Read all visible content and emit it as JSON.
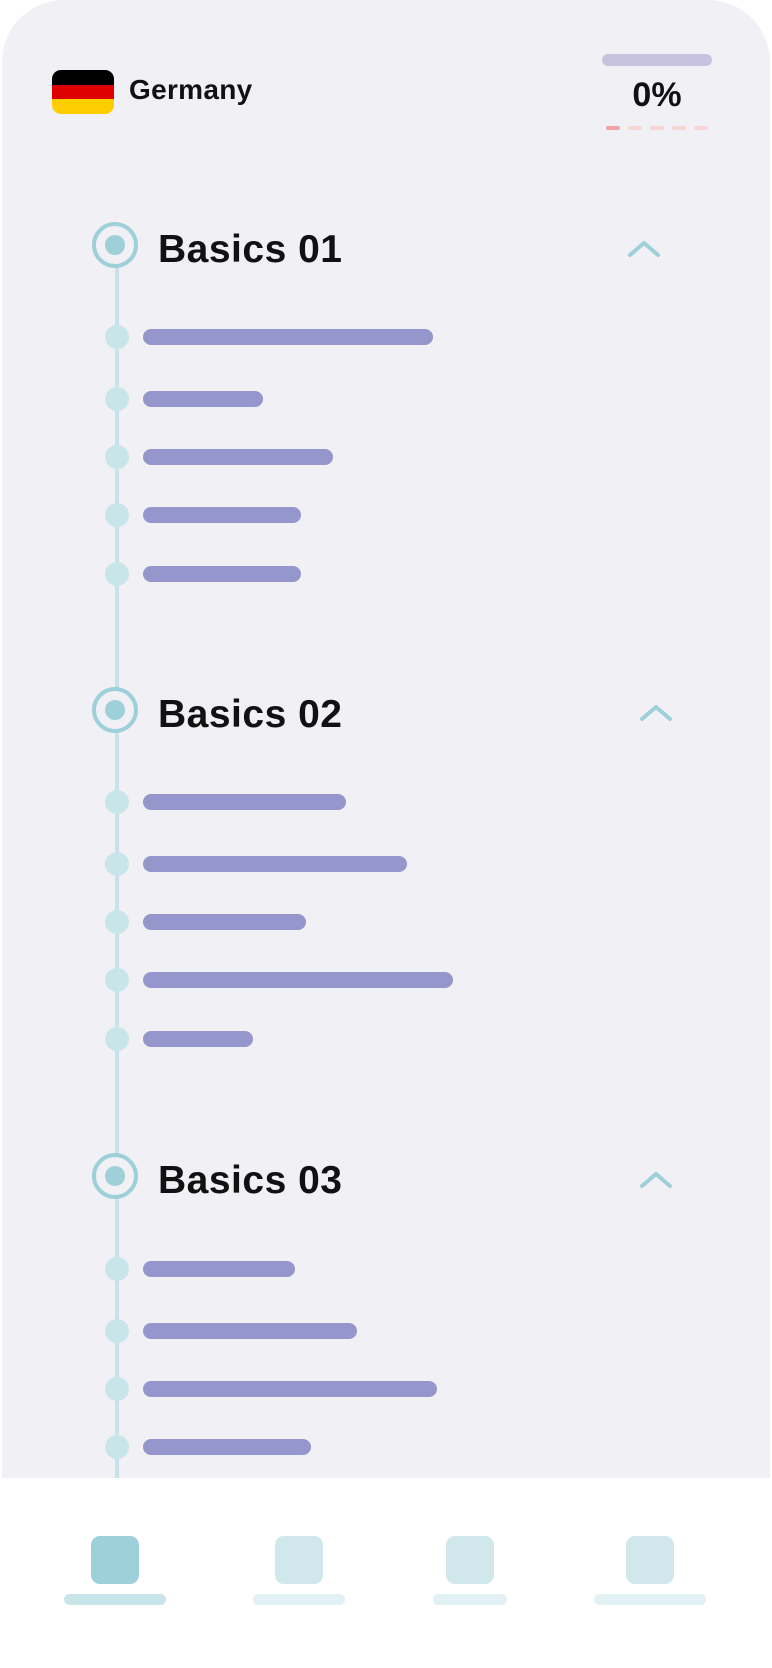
{
  "header": {
    "country": "Germany",
    "flag_colors": [
      "#000000",
      "#dd0000",
      "#ffce00"
    ],
    "progress_percent": 0,
    "progress_label": "0%"
  },
  "sections": [
    {
      "title": "Basics 01",
      "expanded": true,
      "item_count": 5
    },
    {
      "title": "Basics 02",
      "expanded": true,
      "item_count": 5
    },
    {
      "title": "Basics 03",
      "expanded": true,
      "item_count": 4
    }
  ],
  "bottom_nav": {
    "active_index": 0,
    "tab_count": 4
  },
  "colors": {
    "accent": "#9ed0da",
    "item_bar": "#9596cb",
    "background": "#f1f0f5"
  }
}
